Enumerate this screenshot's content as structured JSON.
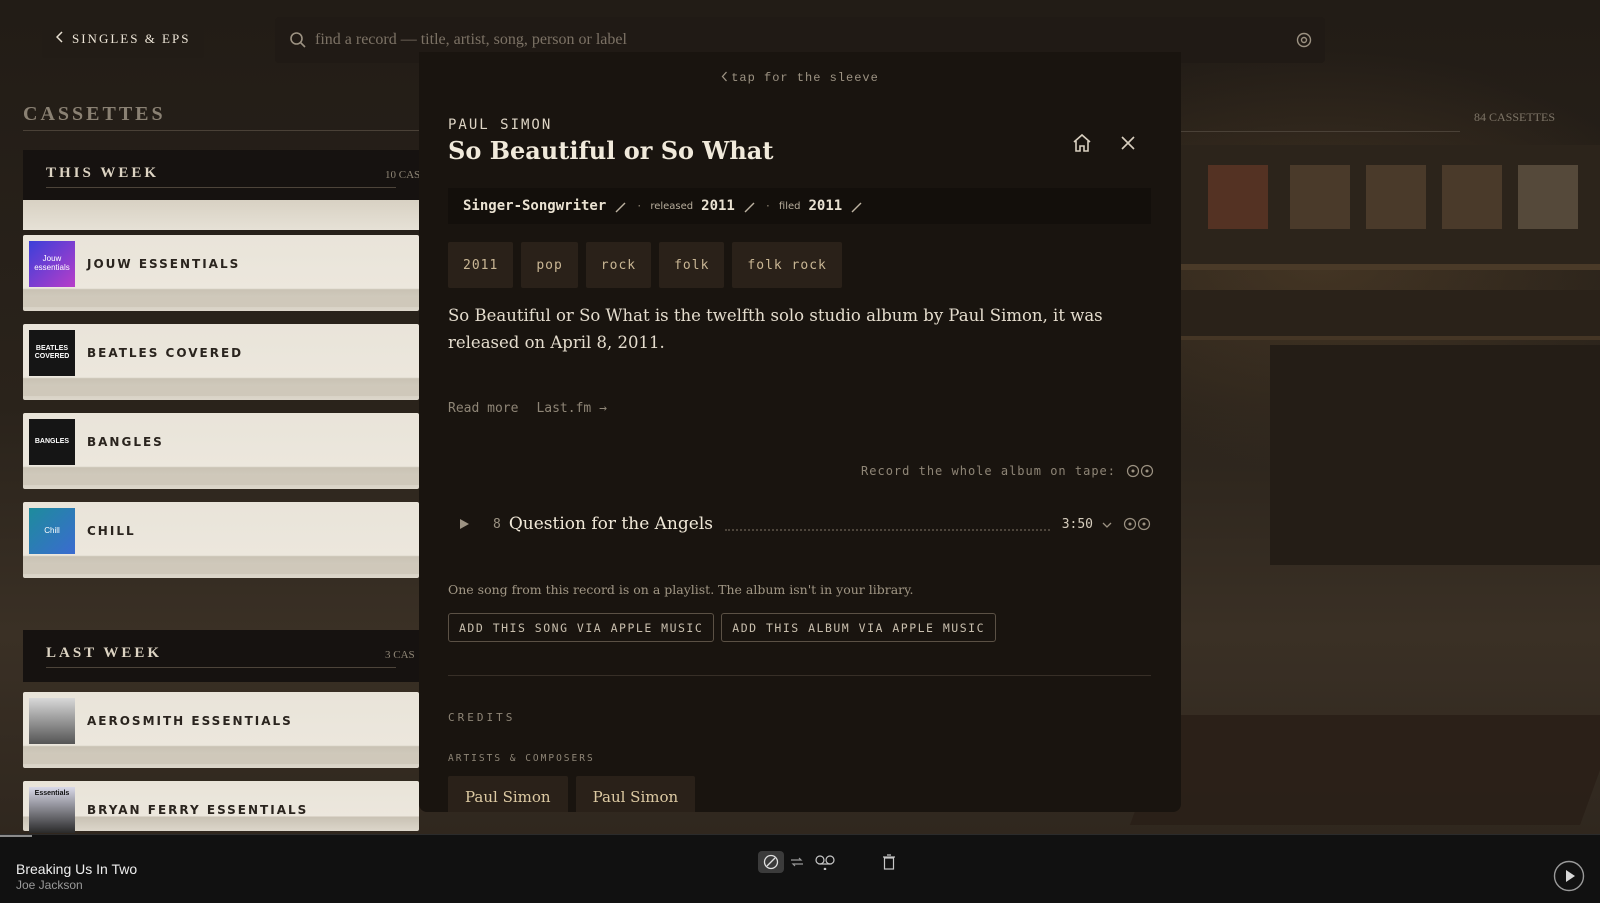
{
  "topbar": {
    "back_label": "SINGLES & EPS",
    "search_placeholder": "find a record — title, artist, song, person or label"
  },
  "left": {
    "title": "CASSETTES",
    "this_week": {
      "name": "THIS WEEK",
      "count": "10 CAS"
    },
    "this_week_tapes": [
      {
        "label": "JOUW ESSENTIALS",
        "art_text": "Jouw essentials"
      },
      {
        "label": "BEATLES COVERED",
        "art_text": "BEATLES COVERED"
      },
      {
        "label": "BANGLES",
        "art_text": "BANGLES"
      },
      {
        "label": "CHILL",
        "art_text": "Chill"
      }
    ],
    "last_week": {
      "name": "LAST WEEK",
      "count": "3 CAS"
    },
    "last_week_tapes": [
      {
        "label": "AEROSMITH ESSENTIALS",
        "art_text": ""
      },
      {
        "label": "BRYAN FERRY ESSENTIALS",
        "art_text": "Essentials"
      }
    ]
  },
  "right": {
    "count": "84 CASSETTES"
  },
  "modal": {
    "sleeve_link": "tap for the sleeve",
    "artist": "PAUL SIMON",
    "title": "So Beautiful or So What",
    "meta": {
      "genre": "Singer-Songwriter",
      "released_label": "released",
      "released_value": "2011",
      "filed_label": "filed",
      "filed_value": "2011"
    },
    "tags": [
      "2011",
      "pop",
      "rock",
      "folk",
      "folk rock"
    ],
    "description": "So Beautiful or So What is the twelfth solo studio album by Paul Simon, it was released on April 8, 2011.",
    "read_more": "Read more",
    "lastfm": "Last.fm →",
    "record_whole": "Record the whole album on tape:",
    "track": {
      "number": "8",
      "name": "Question for the Angels",
      "duration": "3:50"
    },
    "playlist_note": "One song from this record is on a playlist. The album isn't in your library.",
    "add_song": "ADD THIS SONG VIA APPLE MUSIC",
    "add_album": "ADD THIS ALBUM VIA APPLE MUSIC",
    "credits_title": "CREDITS",
    "artists_title": "ARTISTS & COMPOSERS",
    "credits": [
      "Paul Simon",
      "Paul Simon"
    ]
  },
  "player": {
    "track_title": "Breaking Us In Two",
    "track_artist": "Joe Jackson",
    "progress": 0.02
  },
  "colors": {
    "accent": "#c9b694",
    "modal_bg": "#19140f",
    "tape": "#e9e4d9"
  }
}
